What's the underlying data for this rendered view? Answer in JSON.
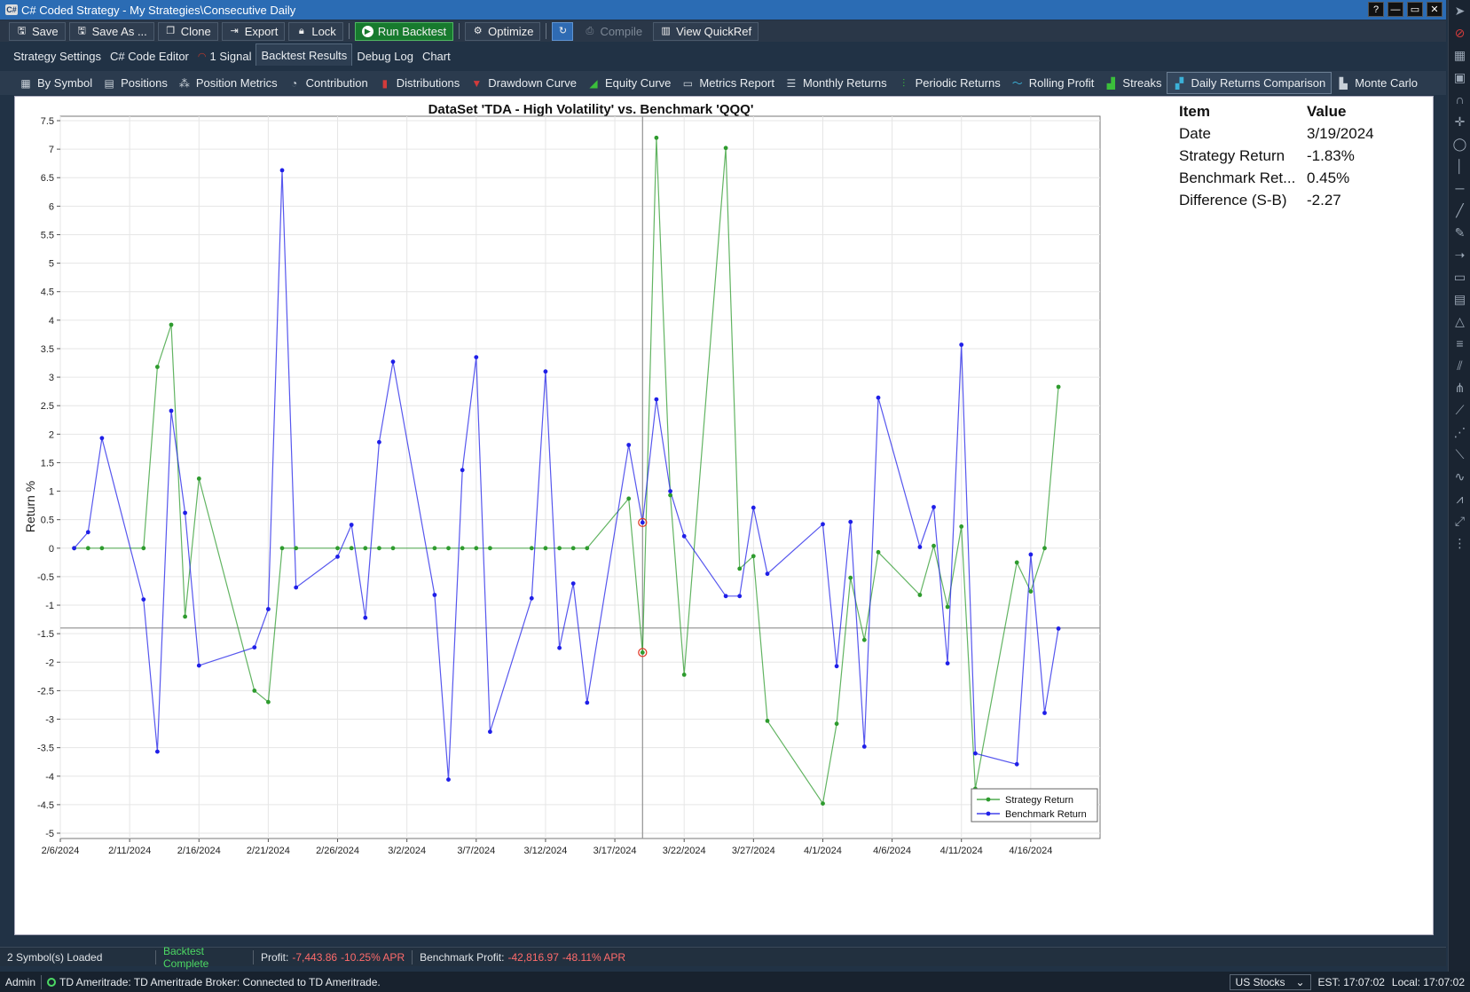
{
  "window": {
    "title": "C# Coded Strategy - My Strategies\\Consecutive Daily",
    "app_icon": "C#",
    "controls": [
      "?",
      "—",
      "▭",
      "✕"
    ]
  },
  "toolbar": {
    "save": "Save",
    "save_as": "Save As ...",
    "clone": "Clone",
    "export": "Export",
    "lock": "Lock",
    "run_backtest": "Run Backtest",
    "optimize": "Optimize",
    "compile": "Compile",
    "view_quickref": "View QuickRef"
  },
  "main_tabs": [
    {
      "label": "Strategy Settings"
    },
    {
      "label": "C# Code Editor"
    },
    {
      "label": "1 Signal"
    },
    {
      "label": "Backtest Results"
    },
    {
      "label": "Debug Log"
    },
    {
      "label": "Chart"
    }
  ],
  "sub_tabs": [
    {
      "label": "By Symbol",
      "icon": "▦"
    },
    {
      "label": "Positions",
      "icon": "▤"
    },
    {
      "label": "Position Metrics",
      "icon": "⁂"
    },
    {
      "label": "Contribution",
      "icon": "◔"
    },
    {
      "label": "Distributions",
      "icon": "▮"
    },
    {
      "label": "Drawdown Curve",
      "icon": "▼"
    },
    {
      "label": "Equity Curve",
      "icon": "◢"
    },
    {
      "label": "Metrics Report",
      "icon": "▭"
    },
    {
      "label": "Monthly Returns",
      "icon": "☰"
    },
    {
      "label": "Periodic Returns",
      "icon": "⫶"
    },
    {
      "label": "Rolling Profit",
      "icon": "〜"
    },
    {
      "label": "Streaks",
      "icon": "▟"
    },
    {
      "label": "Daily Returns Comparison",
      "icon": "▞"
    },
    {
      "label": "Monte Carlo",
      "icon": "▙"
    }
  ],
  "info_panel": {
    "header_item": "Item",
    "header_value": "Value",
    "rows": [
      {
        "item": "Date",
        "value": "3/19/2024"
      },
      {
        "item": "Strategy Return",
        "value": "-1.83%"
      },
      {
        "item": "Benchmark Ret...",
        "value": "0.45%"
      },
      {
        "item": "Difference (S-B)",
        "value": "-2.27"
      }
    ]
  },
  "chart_data": {
    "type": "line",
    "title": "DataSet 'TDA - High Volatility' vs. Benchmark 'QQQ'",
    "xlabel": "",
    "ylabel": "Return %",
    "xlim": [
      "2024-02-06",
      "2024-04-21"
    ],
    "ylim": [
      -5,
      7.5
    ],
    "y_ticks": [
      7.5,
      7,
      6.5,
      6,
      5.5,
      5,
      4.5,
      4,
      3.5,
      3,
      2.5,
      2,
      1.5,
      1,
      0.5,
      0,
      -0.5,
      -1,
      -1.5,
      -2,
      -2.5,
      -3,
      -3.5,
      -4,
      -4.5,
      -5
    ],
    "x_ticks": [
      "2/6/2024",
      "2/11/2024",
      "2/16/2024",
      "2/21/2024",
      "2/26/2024",
      "3/2/2024",
      "3/7/2024",
      "3/12/2024",
      "3/17/2024",
      "3/22/2024",
      "3/27/2024",
      "4/1/2024",
      "4/6/2024",
      "4/11/2024",
      "4/16/2024"
    ],
    "grid": true,
    "legend": "bottom-right",
    "crosshair": {
      "date": "2024-03-19",
      "value": -1.4
    },
    "series": [
      {
        "name": "Strategy Return",
        "color": "#2e9b2e",
        "x": [
          "2024-02-07",
          "2024-02-08",
          "2024-02-09",
          "2024-02-12",
          "2024-02-13",
          "2024-02-14",
          "2024-02-15",
          "2024-02-16",
          "2024-02-20",
          "2024-02-21",
          "2024-02-22",
          "2024-02-23",
          "2024-02-26",
          "2024-02-27",
          "2024-02-28",
          "2024-02-29",
          "2024-03-01",
          "2024-03-04",
          "2024-03-05",
          "2024-03-06",
          "2024-03-07",
          "2024-03-08",
          "2024-03-11",
          "2024-03-12",
          "2024-03-13",
          "2024-03-14",
          "2024-03-15",
          "2024-03-18",
          "2024-03-19",
          "2024-03-20",
          "2024-03-21",
          "2024-03-22",
          "2024-03-25",
          "2024-03-26",
          "2024-03-27",
          "2024-03-28",
          "2024-04-01",
          "2024-04-02",
          "2024-04-03",
          "2024-04-04",
          "2024-04-05",
          "2024-04-08",
          "2024-04-09",
          "2024-04-10",
          "2024-04-11",
          "2024-04-12",
          "2024-04-15",
          "2024-04-16",
          "2024-04-17",
          "2024-04-18"
        ],
        "values": [
          0,
          0,
          0,
          0,
          3.18,
          3.92,
          -1.2,
          1.22,
          -2.5,
          -2.7,
          0,
          0,
          0,
          0,
          0,
          0,
          0,
          0,
          0,
          0,
          0,
          0,
          0,
          0,
          0,
          0,
          0,
          0.87,
          -1.83,
          7.2,
          0.93,
          -2.22,
          7.02,
          -0.36,
          -0.14,
          -3.03,
          -4.48,
          -3.08,
          -0.52,
          -1.61,
          -0.07,
          -0.82,
          0.04,
          -1.03,
          0.38,
          -4.22,
          -0.25,
          -0.76,
          0,
          2.83
        ]
      },
      {
        "name": "Benchmark Return",
        "color": "#1f1fe8",
        "x": [
          "2024-02-07",
          "2024-02-08",
          "2024-02-09",
          "2024-02-12",
          "2024-02-13",
          "2024-02-14",
          "2024-02-15",
          "2024-02-16",
          "2024-02-20",
          "2024-02-21",
          "2024-02-22",
          "2024-02-23",
          "2024-02-26",
          "2024-02-27",
          "2024-02-28",
          "2024-02-29",
          "2024-03-01",
          "2024-03-04",
          "2024-03-05",
          "2024-03-06",
          "2024-03-07",
          "2024-03-08",
          "2024-03-11",
          "2024-03-12",
          "2024-03-13",
          "2024-03-14",
          "2024-03-15",
          "2024-03-18",
          "2024-03-19",
          "2024-03-20",
          "2024-03-21",
          "2024-03-22",
          "2024-03-25",
          "2024-03-26",
          "2024-03-27",
          "2024-03-28",
          "2024-04-01",
          "2024-04-02",
          "2024-04-03",
          "2024-04-04",
          "2024-04-05",
          "2024-04-08",
          "2024-04-09",
          "2024-04-10",
          "2024-04-11",
          "2024-04-12",
          "2024-04-15",
          "2024-04-16",
          "2024-04-17",
          "2024-04-18"
        ],
        "values": [
          0,
          0.28,
          1.93,
          -0.9,
          -3.57,
          2.41,
          0.62,
          -2.06,
          -1.74,
          -1.07,
          6.63,
          -0.69,
          -0.15,
          0.41,
          -1.22,
          1.86,
          3.27,
          -0.82,
          -4.06,
          1.37,
          3.35,
          -3.22,
          -0.88,
          3.1,
          -1.75,
          -0.62,
          -2.71,
          1.81,
          0.45,
          2.61,
          1.0,
          0.21,
          -0.84,
          -0.84,
          0.71,
          -0.45,
          0.42,
          -2.07,
          0.46,
          -3.48,
          2.64,
          0.02,
          0.72,
          -2.02,
          3.57,
          -3.6,
          -3.79,
          -0.11,
          -2.89,
          -1.41
        ]
      }
    ],
    "highlight_points": [
      {
        "date": "2024-03-19",
        "value": 0.45
      },
      {
        "date": "2024-03-19",
        "value": -1.83
      }
    ]
  },
  "status": {
    "symbols_loaded": "2 Symbol(s) Loaded",
    "backtest": "Backtest Complete",
    "profit_label": "Profit:",
    "profit_value": "-7,443.86",
    "profit_apr": "-10.25% APR",
    "bench_label": "Benchmark Profit:",
    "bench_value": "-42,816.97",
    "bench_apr": "-48.11% APR"
  },
  "connection": {
    "user": "Admin",
    "broker": "TD Ameritrade: TD Ameritrade Broker: Connected to TD Ameritrade.",
    "market": "US Stocks",
    "est": "EST: 17:07:02",
    "local": "Local: 17:07:02"
  }
}
